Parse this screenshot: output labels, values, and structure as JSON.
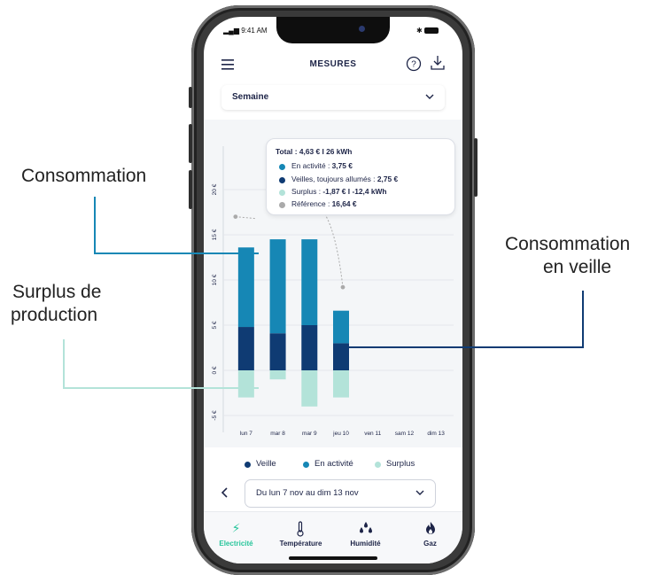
{
  "callouts": {
    "consommation": "Consommation",
    "surplus_line1": "Surplus de",
    "surplus_line2": "production",
    "veille_line1": "Consommation",
    "veille_line2": "en veille"
  },
  "status_bar": {
    "time": "9:41 AM"
  },
  "header": {
    "title": "MESURES"
  },
  "period_select": {
    "value": "Semaine"
  },
  "tooltip": {
    "total_label": "Total : ",
    "total_value": "4,63 € I 26 kWh",
    "activite_label": "En activité : ",
    "activite_value": "3,75 €",
    "veilles_label": "Veilles, toujours allumés : ",
    "veilles_value": "2,75 €",
    "surplus_label": "Surplus : ",
    "surplus_value": "-1,87 € I -12,4 kWh",
    "reference_label": "Référence : ",
    "reference_value": "16,64 €"
  },
  "legend": {
    "veille": "Veille",
    "activite": "En activité",
    "surplus": "Surplus"
  },
  "date_range": {
    "value": "Du lun 7 nov au dim 13 nov"
  },
  "tabs": [
    {
      "label": "Electricité",
      "icon": "bolt-icon"
    },
    {
      "label": "Température",
      "icon": "thermometer-icon"
    },
    {
      "label": "Humidité",
      "icon": "drops-icon"
    },
    {
      "label": "Gaz",
      "icon": "flame-icon"
    }
  ],
  "colors": {
    "veille": "#0f3b73",
    "activite": "#1687b5",
    "surplus": "#b3e3d9",
    "reference": "#aaaaaa",
    "accent": "#27c59b"
  },
  "chart_data": {
    "type": "bar",
    "stacked": true,
    "categories": [
      "lun 7",
      "mar 8",
      "mar 9",
      "jeu 10",
      "ven 11",
      "sam 12",
      "dim 13"
    ],
    "series": [
      {
        "name": "Veille",
        "values": [
          4.8,
          4.1,
          5.0,
          3.0,
          0,
          0,
          0
        ]
      },
      {
        "name": "En activité",
        "values": [
          8.8,
          10.4,
          9.5,
          3.6,
          0,
          0,
          0
        ]
      },
      {
        "name": "Surplus",
        "values": [
          -3.0,
          -1.0,
          -4.0,
          -3.0,
          0,
          0,
          0
        ]
      }
    ],
    "reference": [
      {
        "x": "lun 7",
        "y": 17.0
      },
      {
        "x": "jeu 10",
        "y": 9.2
      }
    ],
    "y_ticks": [
      "-5 €",
      "0 €",
      "5 €",
      "10 €",
      "15 €",
      "20 €"
    ],
    "ylim": [
      -5,
      25
    ]
  }
}
